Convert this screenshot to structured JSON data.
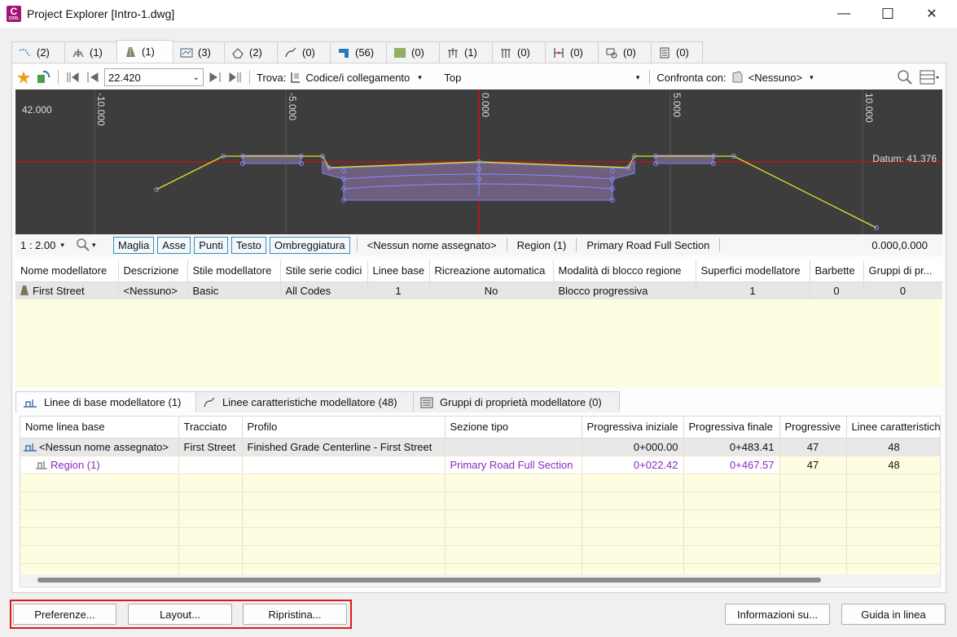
{
  "window": {
    "title": "Project Explorer [Intro-1.dwg]",
    "logo_letter": "C",
    "logo_sub": "CIVIL",
    "minimize": "—",
    "maximize": "☐",
    "close": "✕"
  },
  "top_tabs": [
    {
      "count": "(2)",
      "icon": "alignment-icon"
    },
    {
      "count": "(1)",
      "icon": "assembly-icon"
    },
    {
      "count": "(1)",
      "icon": "corridor-icon"
    },
    {
      "count": "(3)",
      "icon": "profile-icon"
    },
    {
      "count": "(2)",
      "icon": "surface-icon"
    },
    {
      "count": "(0)",
      "icon": "feature-line-icon"
    },
    {
      "count": "(56)",
      "icon": "pipe-network-icon"
    },
    {
      "count": "(0)",
      "icon": "grading-icon"
    },
    {
      "count": "(1)",
      "icon": "subassembly-icon"
    },
    {
      "count": "(0)",
      "icon": "intersection-icon"
    },
    {
      "count": "(0)",
      "icon": "sample-line-icon"
    },
    {
      "count": "(0)",
      "icon": "view-frame-icon"
    },
    {
      "count": "(0)",
      "icon": "sheet-icon"
    }
  ],
  "toolbar": {
    "station_value": "22.420",
    "find_label": "Trova:",
    "find_value": "Codice/i collegamento",
    "find_text": "Top",
    "compare_label": "Confronta con:",
    "compare_value": "<Nessuno>"
  },
  "viewport": {
    "elev_label": "42.000",
    "offset_labels": [
      "-10.000",
      "-5.000",
      "0.000",
      "5.000",
      "10.000"
    ],
    "datum_label": "Datum: 41.376"
  },
  "viewbar": {
    "scale": "1 : 2.00",
    "toggles": [
      "Maglia",
      "Asse",
      "Punti",
      "Testo",
      "Ombreggiatura"
    ],
    "baseline": "<Nessun nome assegnato>",
    "region": "Region (1)",
    "assembly": "Primary Road Full Section",
    "coords": "0.000,0.000"
  },
  "grid1": {
    "headers": [
      "Nome modellatore",
      "Descrizione",
      "Stile modellatore",
      "Stile serie codici",
      "Linee base",
      "Ricreazione automatica",
      "Modalità di blocco regione",
      "Superfici modellatore",
      "Barbette",
      "Gruppi di pr..."
    ],
    "row": [
      "First Street",
      "<Nessuno>",
      "Basic",
      "All Codes",
      "1",
      "No",
      "Blocco progressiva",
      "1",
      "0",
      "0"
    ]
  },
  "sub_tabs": [
    {
      "label": "Linee di base modellatore (1)"
    },
    {
      "label": "Linee caratteristiche modellatore (48)"
    },
    {
      "label": "Gruppi di proprietà modellatore (0)"
    }
  ],
  "grid2": {
    "headers": [
      "Nome linea base",
      "Tracciato",
      "Profilo",
      "Sezione tipo",
      "Progressiva iniziale",
      "Progressiva finale",
      "Progressive",
      "Linee caratteristich"
    ],
    "rows": [
      [
        "<Nessun nome assegnato>",
        "First Street",
        "Finished Grade Centerline - First Street",
        "",
        "0+000.00",
        "0+483.41",
        "47",
        "48"
      ],
      [
        "Region (1)",
        "",
        "",
        "Primary Road Full Section",
        "0+022.42",
        "0+467.57",
        "47",
        "48"
      ]
    ]
  },
  "buttons": {
    "preferences": "Preferenze...",
    "layout": "Layout...",
    "restore": "Ripristina...",
    "about": "Informazioni su...",
    "help": "Guida in linea"
  }
}
